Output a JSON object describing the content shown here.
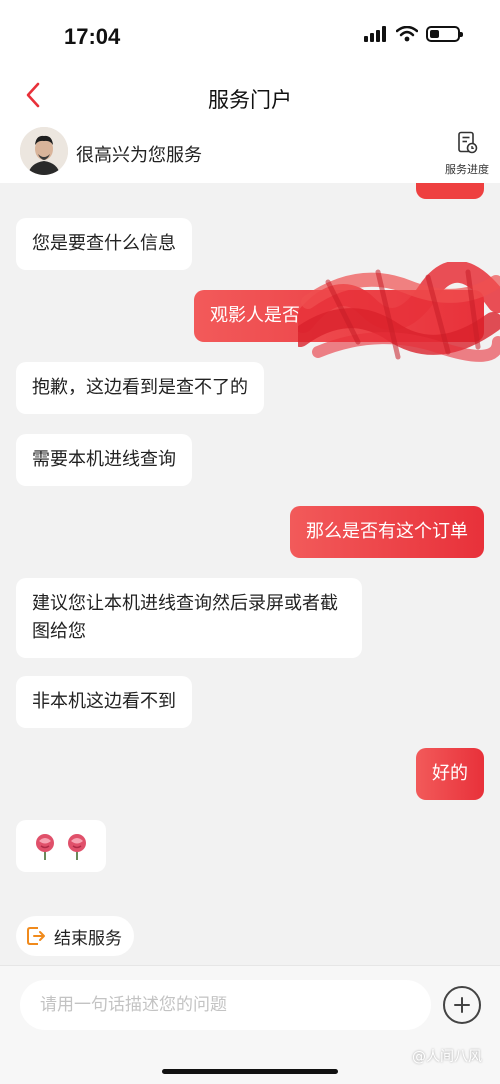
{
  "status_bar": {
    "time": "17:04"
  },
  "nav": {
    "title": "服务门户"
  },
  "agent": {
    "greeting": "很高兴为您服务",
    "progress_label": "服务进度"
  },
  "messages": [
    {
      "side": "left",
      "text": "您是要查什么信息"
    },
    {
      "side": "right",
      "text": "观影人是否"
    },
    {
      "side": "left",
      "text": "抱歉，这边看到是查不了的"
    },
    {
      "side": "left",
      "text": "需要本机进线查询"
    },
    {
      "side": "right",
      "text": "那么是否有这个订单"
    },
    {
      "side": "left",
      "text": "建议您让本机进线查询然后录屏或者截图给您"
    },
    {
      "side": "left",
      "text": "非本机这边看不到"
    },
    {
      "side": "right",
      "text": "好的"
    }
  ],
  "emoji_message": {
    "icons": [
      "rose-icon",
      "rose-icon"
    ]
  },
  "end_service": {
    "label": "结束服务"
  },
  "input": {
    "placeholder": "请用一句话描述您的问题"
  },
  "watermark": "@人间八风",
  "colors": {
    "accent": "#e8313a",
    "bubble_left": "#ffffff",
    "background": "#f2f2f2"
  }
}
